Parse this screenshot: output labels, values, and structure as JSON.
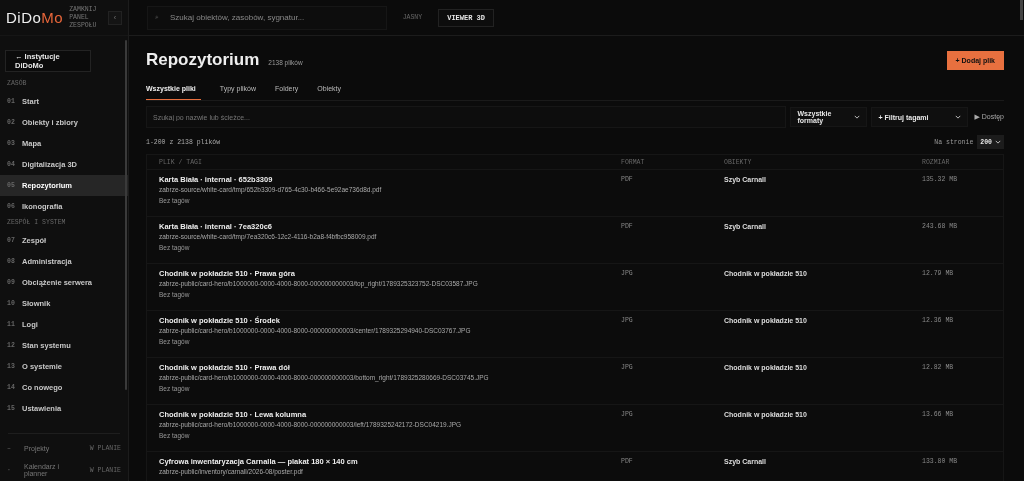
{
  "sidebar": {
    "logo": [
      {
        "text": "DiDo",
        "accent": false
      },
      {
        "text": "Mo",
        "accent": true
      }
    ],
    "panel_label": "ZAMKNIJ PANEL ZESPOŁU",
    "collapse_button": "‹",
    "back_button": "← Instytucje DiDoMo",
    "sections": [
      {
        "title": "ZASÓB",
        "items": [
          {
            "number": "01",
            "label": "Start",
            "selected": false
          },
          {
            "number": "02",
            "label": "Obiekty i zbiory",
            "selected": false
          },
          {
            "number": "03",
            "label": "Mapa",
            "selected": false
          },
          {
            "number": "04",
            "label": "Digitalizacja 3D",
            "selected": false
          },
          {
            "number": "05",
            "label": "Repozytorium",
            "selected": true
          },
          {
            "number": "06",
            "label": "Ikonografia",
            "selected": false
          }
        ]
      },
      {
        "title": "ZESPÓŁ I SYSTEM",
        "items": [
          {
            "number": "07",
            "label": "Zespół",
            "selected": false
          },
          {
            "number": "08",
            "label": "Administracja",
            "selected": false
          },
          {
            "number": "09",
            "label": "Obciążenie serwera",
            "selected": false
          },
          {
            "number": "10",
            "label": "Słownik",
            "selected": false
          },
          {
            "number": "11",
            "label": "Logi",
            "selected": false
          },
          {
            "number": "12",
            "label": "Stan systemu",
            "selected": false
          },
          {
            "number": "13",
            "label": "O systemie",
            "selected": false
          },
          {
            "number": "14",
            "label": "Co nowego",
            "selected": false
          },
          {
            "number": "15",
            "label": "Ustawienia",
            "selected": false
          }
        ]
      }
    ],
    "planned": [
      {
        "mark": "–",
        "label": "Projekty",
        "badge": "W PLANIE"
      },
      {
        "mark": "·",
        "label": "Kalendarz i planner",
        "badge": "W PLANIE"
      }
    ]
  },
  "topbar": {
    "search_placeholder": "Szukaj obiektów, zasobów, sygnatur...",
    "search_icon": "⌕",
    "theme_toggle": "JASNY",
    "viewer_button": "VIEWER 3D"
  },
  "page": {
    "title": "Repozytorium",
    "count": "2138 plików",
    "add_button": "+ Dodaj plik"
  },
  "tabs": [
    {
      "label": "Wszystkie pliki",
      "selected": true
    },
    {
      "label": "Typy plików",
      "selected": false
    },
    {
      "label": "Foldery",
      "selected": false
    },
    {
      "label": "Obiekty",
      "selected": false
    }
  ],
  "filters": {
    "search_placeholder": "Szukaj po nazwie lub ścieżce...",
    "format_select": "Wszystkie formaty",
    "tag_select": "+ Filtruj tagami",
    "access_toggle": "▶ Dostęp"
  },
  "summary": "1-200 z 2138 plików",
  "per_page": {
    "label": "Na stronie",
    "value": "200"
  },
  "table": {
    "columns": [
      "PLIK / TAGI",
      "FORMAT",
      "OBIEKTY",
      "ROZMIAR"
    ],
    "rows": [
      {
        "title": "Karta Biała · internal · 652b3309",
        "path": "zabrze-source/white-card/tmp/652b3309-d765-4c30-b466-5e92ae736d8d.pdf",
        "tags": "Bez tagów",
        "format": "PDF",
        "object": "Szyb Carnall",
        "size": "135.32 MB"
      },
      {
        "title": "Karta Biała · internal · 7ea320c6",
        "path": "zabrze-source/white-card/tmp/7ea320c6-12c2-4116-b2a8-f4bfbc958009.pdf",
        "tags": "Bez tagów",
        "format": "PDF",
        "object": "Szyb Carnall",
        "size": "243.68 MB"
      },
      {
        "title": "Chodnik w pokładzie 510 · Prawa góra",
        "path": "zabrze-public/card-hero/b1000000-0000-4000-8000-000000000003/top_right/1789325323752-DSC03587.JPG",
        "tags": "Bez tagów",
        "format": "JPG",
        "object": "Chodnik w pokładzie 510",
        "size": "12.79 MB"
      },
      {
        "title": "Chodnik w pokładzie 510 · Środek",
        "path": "zabrze-public/card-hero/b1000000-0000-4000-8000-000000000003/center/1789325294940-DSC03767.JPG",
        "tags": "Bez tagów",
        "format": "JPG",
        "object": "Chodnik w pokładzie 510",
        "size": "12.36 MB"
      },
      {
        "title": "Chodnik w pokładzie 510 · Prawa dół",
        "path": "zabrze-public/card-hero/b1000000-0000-4000-8000-000000000003/bottom_right/1789325280669-DSC03745.JPG",
        "tags": "Bez tagów",
        "format": "JPG",
        "object": "Chodnik w pokładzie 510",
        "size": "12.82 MB"
      },
      {
        "title": "Chodnik w pokładzie 510 · Lewa kolumna",
        "path": "zabrze-public/card-hero/b1000000-0000-4000-8000-000000000003/left/1789325242172-DSC04219.JPG",
        "tags": "Bez tagów",
        "format": "JPG",
        "object": "Chodnik w pokładzie 510",
        "size": "13.66 MB"
      },
      {
        "title": "Cyfrowa inwentaryzacja Carnalla — plakat 180 × 140 cm",
        "path": "zabrze-public/inventory/carnall/2026-08/poster.pdf",
        "format": "PDF",
        "object": "Szyb Carnall",
        "size": "133.80 MB"
      }
    ]
  }
}
